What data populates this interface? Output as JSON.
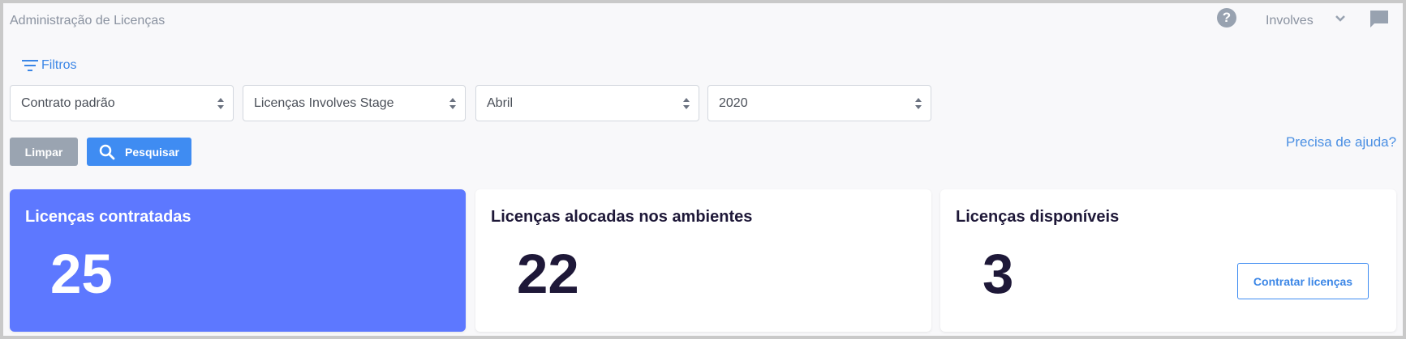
{
  "header": {
    "title": "Administração de Licenças",
    "account": "Involves",
    "icons": [
      "help-icon",
      "chevron-down-icon",
      "chat-icon"
    ]
  },
  "filters": {
    "toggle_label": "Filtros",
    "contract": {
      "value": "Contrato padrão"
    },
    "license_type": {
      "value": "Licenças Involves Stage"
    },
    "month": {
      "value": "Abril"
    },
    "year": {
      "value": "2020"
    },
    "clear_label": "Limpar",
    "search_label": "Pesquisar"
  },
  "help_link": "Precisa de ajuda?",
  "cards": {
    "contracted": {
      "title": "Licenças contratadas",
      "value": "25"
    },
    "allocated": {
      "title": "Licenças alocadas nos ambientes",
      "value": "22"
    },
    "available": {
      "title": "Licenças disponíveis",
      "value": "3",
      "action_label": "Contratar licenças"
    }
  },
  "colors": {
    "accent": "#3f8cf2",
    "primary_card": "#5d78ff",
    "muted_button": "#9aa4b1",
    "value_text": "#1e1838"
  }
}
